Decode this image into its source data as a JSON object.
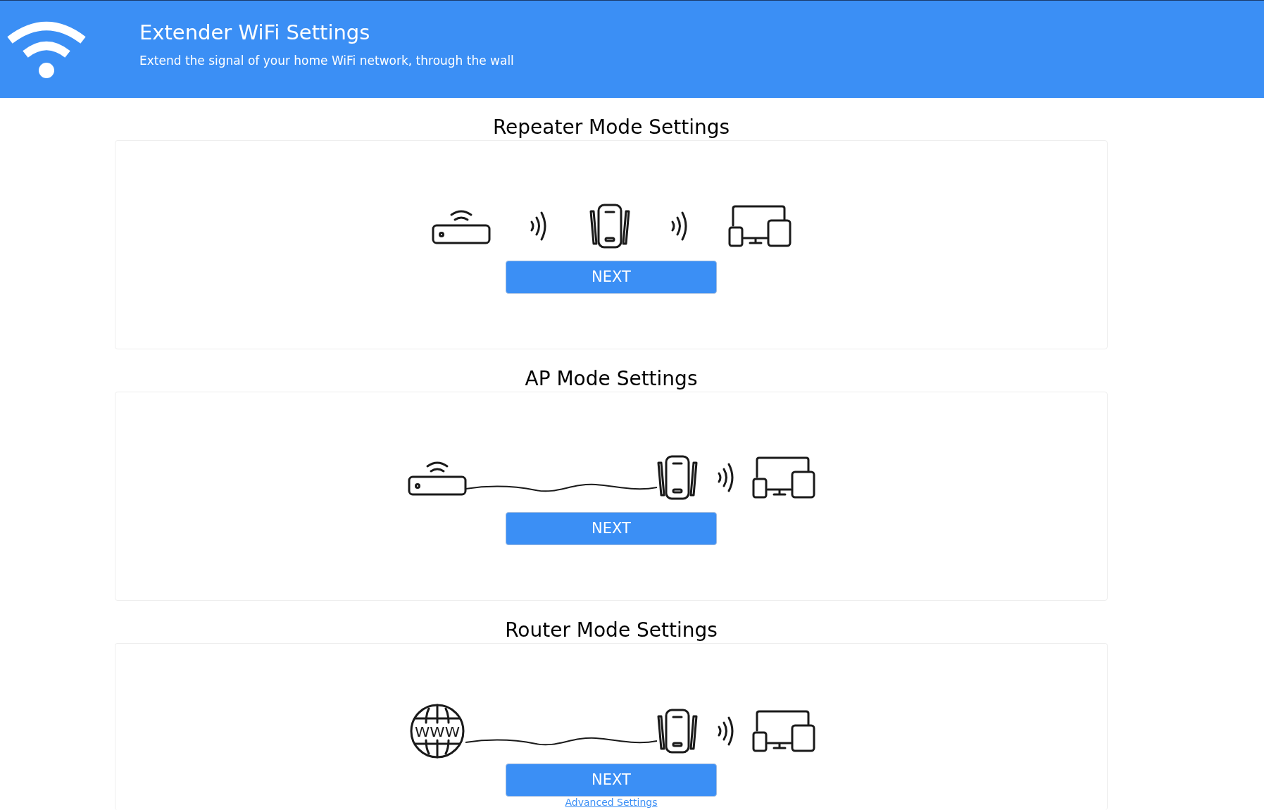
{
  "header": {
    "title": "Extender WiFi Settings",
    "subtitle": "Extend the signal of your home WiFi network, through the wall"
  },
  "sections": [
    {
      "kind": "repeater",
      "title": "Repeater Mode Settings",
      "button": "NEXT"
    },
    {
      "kind": "ap",
      "title": "AP Mode Settings",
      "button": "NEXT"
    },
    {
      "kind": "router",
      "title": "Router Mode Settings",
      "button": "NEXT",
      "icon_text": "WWW"
    }
  ],
  "advanced_link": "Advanced Settings"
}
